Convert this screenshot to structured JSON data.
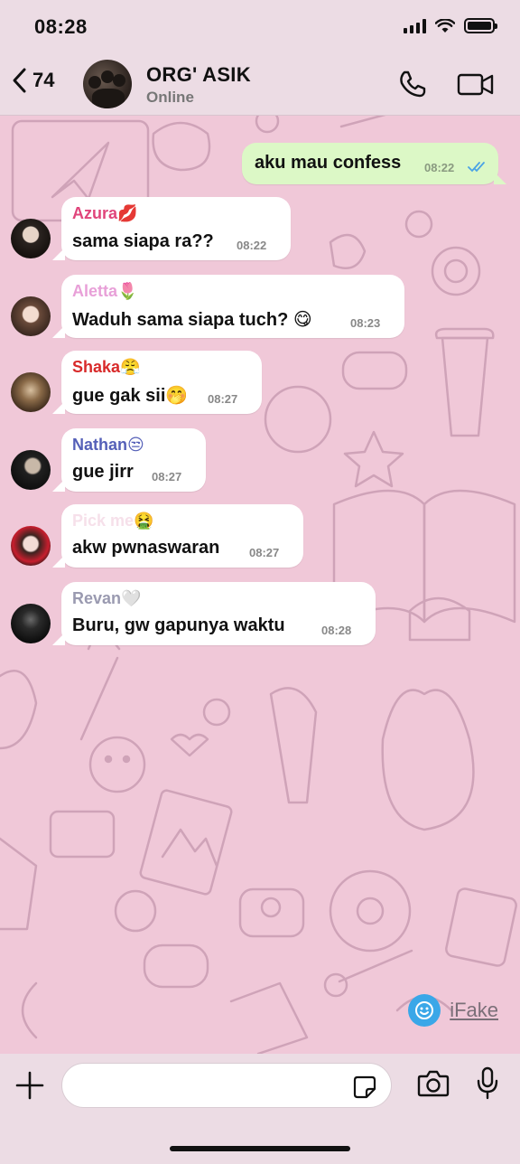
{
  "status_bar": {
    "time": "08:28"
  },
  "header": {
    "back_count": "74",
    "title": "ORG' ASIK",
    "subtitle": "Online"
  },
  "messages": [
    {
      "direction": "outgoing",
      "text": "aku mau confess",
      "time": "08:22",
      "read": true
    },
    {
      "direction": "incoming",
      "sender": "Azura💋",
      "sender_color": "#e0457b",
      "text": "sama siapa ra??",
      "time": "08:22"
    },
    {
      "direction": "incoming",
      "sender": "Aletta🌷",
      "sender_color": "#e8a0d8",
      "text": "Waduh sama siapa tuch? 😋",
      "time": "08:23"
    },
    {
      "direction": "incoming",
      "sender": "Shaka😤",
      "sender_color": "#d82a2a",
      "text": "gue gak sii🤭",
      "time": "08:27"
    },
    {
      "direction": "incoming",
      "sender": "Nathan😒",
      "sender_color": "#5560b8",
      "text": "gue jirr",
      "time": "08:27"
    },
    {
      "direction": "incoming",
      "sender": "Pick me🤮",
      "sender_color": "#f6e0ea",
      "text": "akw pwnaswaran",
      "time": "08:27"
    },
    {
      "direction": "incoming",
      "sender": "Revan🤍",
      "sender_color": "#9a9ab0",
      "text": "Buru, gw gapunya waktu",
      "time": "08:28"
    }
  ],
  "watermark": {
    "label": "iFake"
  },
  "input": {
    "value": "",
    "placeholder": ""
  },
  "colors": {
    "chat_background": "#f0c8d8",
    "bar_background": "#ecdce4",
    "outgoing_bubble": "#dcf8c6",
    "read_tick": "#4aa3e6"
  }
}
